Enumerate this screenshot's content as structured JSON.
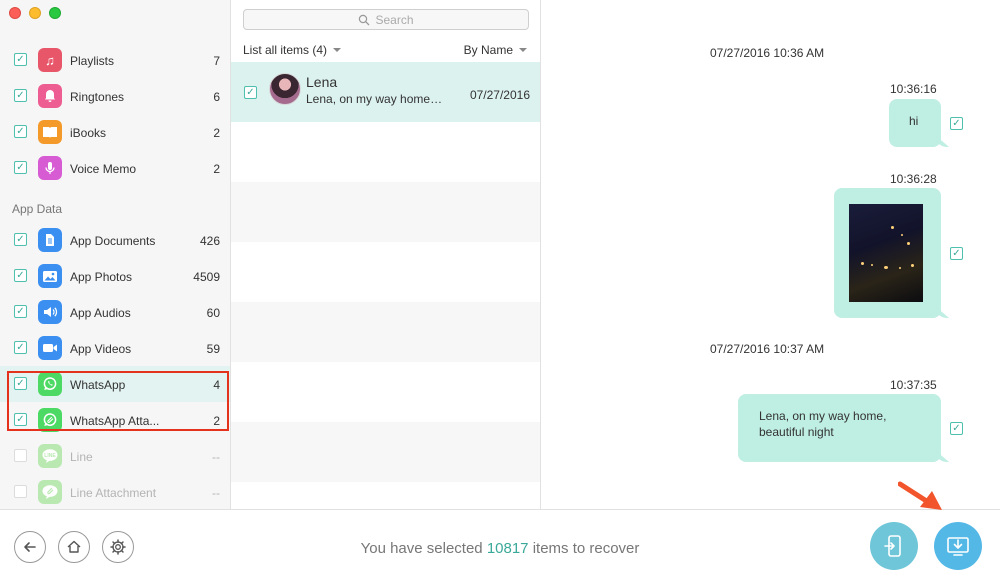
{
  "sidebar": {
    "media_items": [
      {
        "label": "Playlists",
        "count": "7",
        "icon": "playlist-icon",
        "color": "#e8566a"
      },
      {
        "label": "Ringtones",
        "count": "6",
        "icon": "bell-icon",
        "color": "#ee5d91"
      },
      {
        "label": "iBooks",
        "count": "2",
        "icon": "book-icon",
        "color": "#f39a2b"
      },
      {
        "label": "Voice Memo",
        "count": "2",
        "icon": "microphone-icon",
        "color": "#d75bd3"
      }
    ],
    "section_title": "App Data",
    "app_items": [
      {
        "label": "App Documents",
        "count": "426",
        "icon": "document-icon",
        "color": "#3a8ff0"
      },
      {
        "label": "App Photos",
        "count": "4509",
        "icon": "photo-icon",
        "color": "#3a8ff0"
      },
      {
        "label": "App Audios",
        "count": "60",
        "icon": "speaker-icon",
        "color": "#3a8ff0"
      },
      {
        "label": "App Videos",
        "count": "59",
        "icon": "video-camera-icon",
        "color": "#3a8ff0"
      },
      {
        "label": "WhatsApp",
        "count": "4",
        "icon": "whatsapp-icon",
        "color": "#4cd964"
      },
      {
        "label": "WhatsApp Atta...",
        "count": "2",
        "icon": "whatsapp-attachment-icon",
        "color": "#4cd964"
      },
      {
        "label": "Line",
        "count": "--",
        "icon": "line-icon",
        "color": "#b9e8b1"
      },
      {
        "label": "Line Attachment",
        "count": "--",
        "icon": "line-attachment-icon",
        "color": "#b9e8b1"
      }
    ]
  },
  "middle": {
    "search_placeholder": "Search",
    "filter_label": "List all items (4)",
    "sort_label": "By Name",
    "conversation": {
      "name": "Lena",
      "preview": "Lena, on my way home…",
      "date": "07/27/2016"
    }
  },
  "chat": {
    "messages": [
      {
        "kind": "date",
        "text": "07/27/2016 10:36 AM"
      },
      {
        "kind": "time",
        "text": "10:36:16"
      },
      {
        "kind": "text",
        "text": "hi"
      },
      {
        "kind": "time",
        "text": "10:36:28"
      },
      {
        "kind": "image",
        "text": ""
      },
      {
        "kind": "date",
        "text": "07/27/2016 10:37 AM"
      },
      {
        "kind": "time",
        "text": "10:37:35"
      },
      {
        "kind": "text",
        "text": "Lena, on my way home,\nbeautiful night"
      }
    ]
  },
  "bottom": {
    "status_prefix": "You have selected ",
    "status_count": "10817",
    "status_suffix": " items to recover"
  },
  "colors": {
    "accent": "#3aa999",
    "bubble": "#bfeee3",
    "highlight": "#e5321d",
    "arrow": "#f2552c",
    "to_device_button": "#6ec6d8",
    "to_computer_button": "#54b8e6"
  }
}
